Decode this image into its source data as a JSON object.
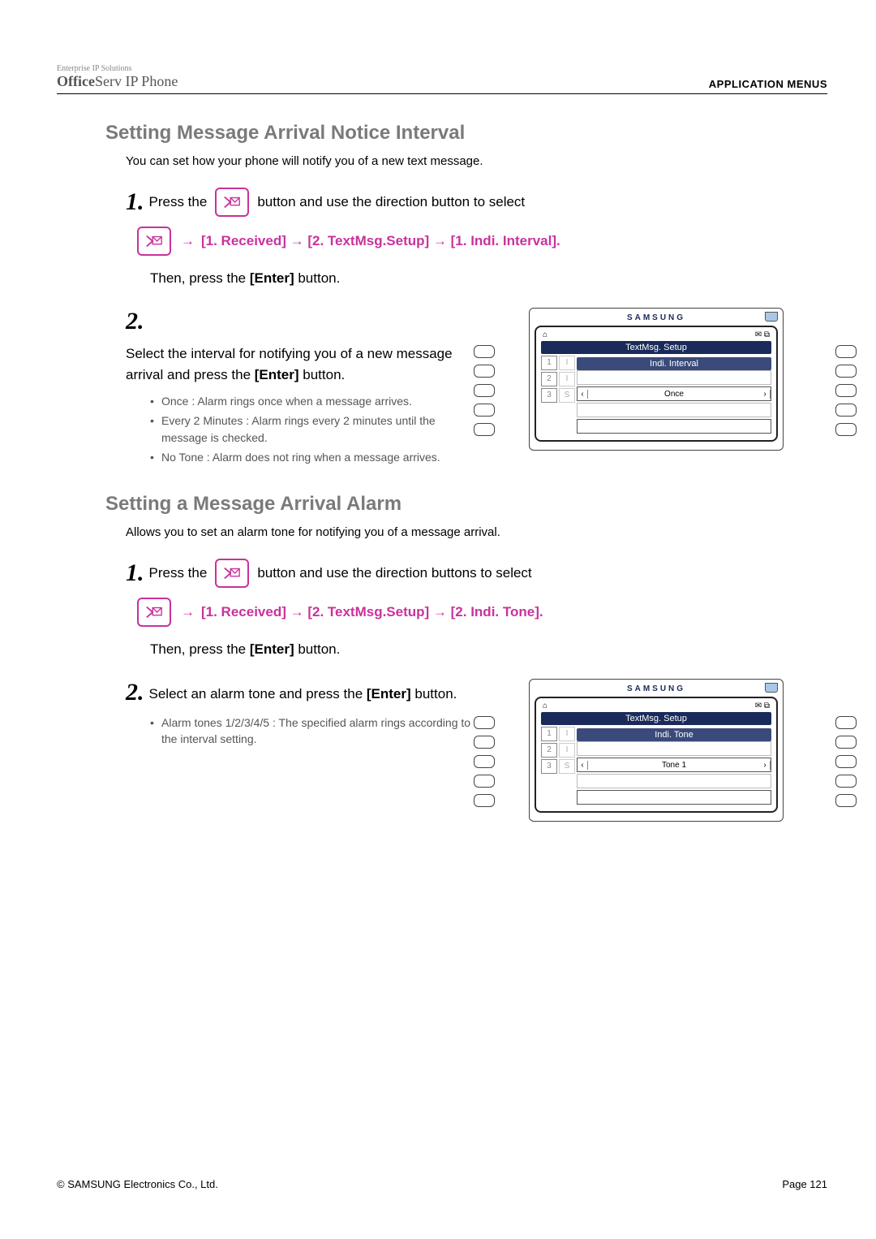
{
  "header": {
    "brand_tiny": "Enterprise IP Solutions",
    "brand_bold": "Office",
    "brand_rest": "Serv",
    "brand_tail": " IP Phone",
    "right": "APPLICATION MENUS"
  },
  "section1": {
    "title": "Setting Message Arrival Notice Interval",
    "intro": "You can set how your phone will notify you of a new text message.",
    "step1_a": "Press the",
    "step1_b": "button and use the direction button to select",
    "path": " [1. Received] → [2. TextMsg.Setup] → [1. Indi. Interval].",
    "then_a": "Then, press the ",
    "then_b": "[Enter]",
    "then_c": " button.",
    "step2_a": "Select the interval for notifying you of a new message arrival and press the ",
    "step2_b": "[Enter]",
    "step2_c": " button.",
    "bullets": [
      "Once : Alarm rings once when a message arrives.",
      "Every 2 Minutes : Alarm rings every 2 minutes until the message is checked.",
      "No Tone : Alarm does not ring when a message arrives."
    ],
    "device": {
      "brand": "SAMSUNG",
      "title": "TextMsg. Setup",
      "subtitle": "Indi. Interval",
      "nums": [
        "1",
        "2",
        "3"
      ],
      "labs": [
        "I",
        "I",
        "S"
      ],
      "value": "Once"
    }
  },
  "section2": {
    "title": "Setting a Message Arrival Alarm",
    "intro": "Allows you to set an alarm tone for notifying you of a message arrival.",
    "step1_a": "Press the",
    "step1_b": "button and use the direction buttons to select",
    "path": " [1. Received] → [2. TextMsg.Setup] → [2. Indi. Tone].",
    "then_a": "Then, press the ",
    "then_b": "[Enter]",
    "then_c": " button.",
    "step2_a": "Select an alarm tone and press the ",
    "step2_b": "[Enter]",
    "step2_c": " button.",
    "bullets": [
      "Alarm tones 1/2/3/4/5 : The specified alarm rings according to the interval setting."
    ],
    "device": {
      "brand": "SAMSUNG",
      "title": "TextMsg. Setup",
      "subtitle": "Indi. Tone",
      "nums": [
        "1",
        "2",
        "3"
      ],
      "labs": [
        "I",
        "I",
        "S"
      ],
      "value": "Tone 1"
    }
  },
  "footer": {
    "left": "© SAMSUNG Electronics Co., Ltd.",
    "right": "Page 121"
  }
}
